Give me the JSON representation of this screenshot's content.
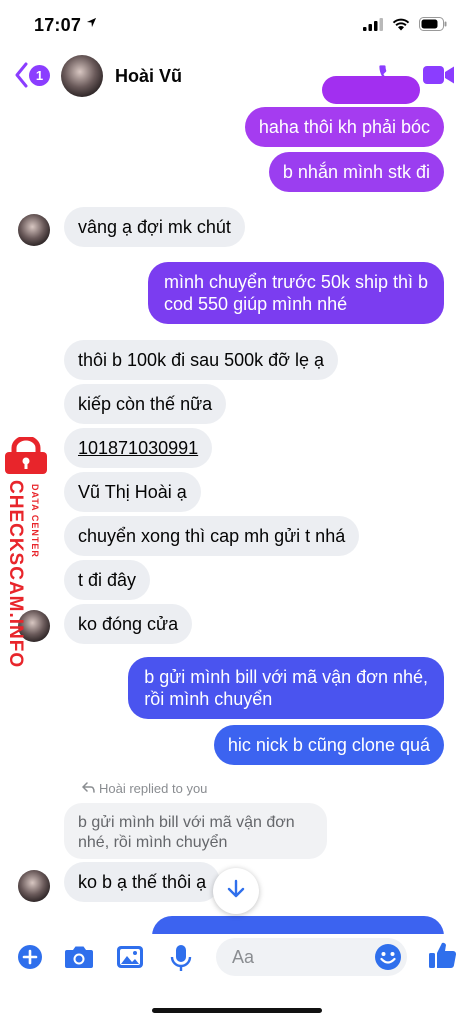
{
  "status": {
    "time": "17:07",
    "location_icon": "location-arrow-icon",
    "signal_icon": "signal-bars-icon",
    "wifi_icon": "wifi-icon",
    "battery_icon": "battery-icon"
  },
  "header": {
    "back_badge": "1",
    "contact_name": "Hoài Vũ",
    "call_icon": "phone-icon",
    "video_icon": "video-camera-icon"
  },
  "messages": [
    {
      "dir": "out",
      "text": "haha thôi kh phải bóc"
    },
    {
      "dir": "out",
      "text": "b nhắn mình stk đi"
    },
    {
      "dir": "in",
      "text": "vâng ạ đợi mk chút"
    },
    {
      "dir": "out",
      "lines": [
        "mình chuyển trước 50k ship thì b",
        "cod 550 giúp mình nhé"
      ]
    },
    {
      "dir": "in",
      "text": "thôi b 100k đi sau 500k đỡ lẹ ạ"
    },
    {
      "dir": "in",
      "text": "kiếp còn thế nữa"
    },
    {
      "dir": "in",
      "text": "101871030991"
    },
    {
      "dir": "in",
      "text": "Vũ Thị Hoài ạ"
    },
    {
      "dir": "in",
      "text": "chuyển xong thì cap mh gửi t nhá"
    },
    {
      "dir": "in",
      "text": "t đi đây"
    },
    {
      "dir": "in",
      "text": "ko đóng cửa"
    },
    {
      "dir": "out",
      "lines": [
        "b gửi mình bill với mã vận đơn nhé,",
        "rồi mình chuyển"
      ]
    },
    {
      "dir": "out",
      "text": "hic nick b cũng clone quá"
    },
    {
      "dir": "in",
      "text": "ko b ạ thế thôi ạ"
    }
  ],
  "reply": {
    "label": "Hoài replied to you",
    "quoted_lines": [
      "b gửi mình bill với mã vận đơn",
      "nhé, rồi mình chuyển"
    ]
  },
  "composer": {
    "placeholder": "Aa",
    "icons": [
      "plus-icon",
      "camera-icon",
      "image-icon",
      "microphone-icon",
      "emoji-icon",
      "thumbs-up-icon"
    ]
  },
  "watermark": {
    "text": "CHECKSCAM.INFO",
    "subtext": "DATA CENTER"
  },
  "colors": {
    "accent": "#8b3dff",
    "outgoing_purple": "#7b3df0",
    "outgoing_blue": "#3c63f0",
    "incoming": "#eceef2",
    "watermark": "#e8252b"
  }
}
